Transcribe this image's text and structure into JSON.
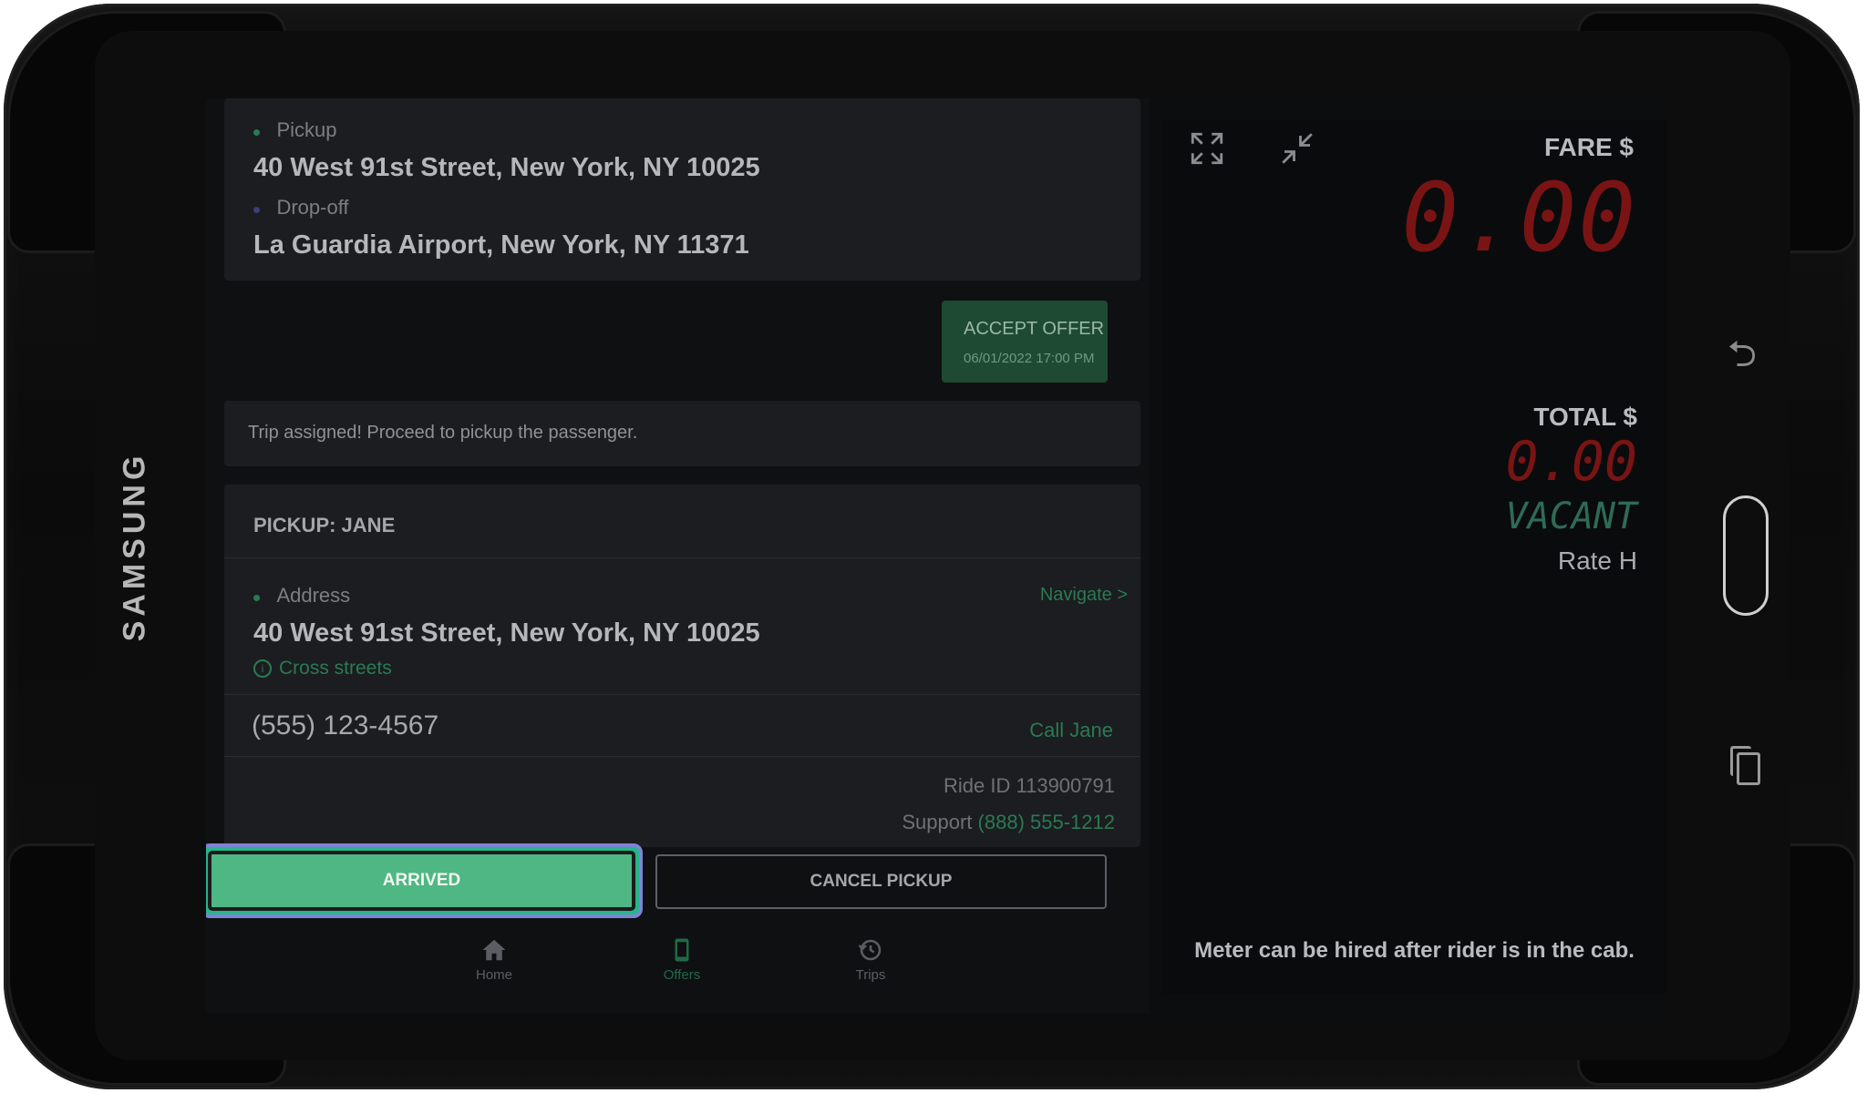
{
  "device": {
    "brand": "SAMSUNG"
  },
  "trip": {
    "pickup_label": "Pickup",
    "pickup_address": "40 West 91st Street, New York, NY 10025",
    "dropoff_label": "Drop-off",
    "dropoff_address": "La Guardia Airport, New York, NY 11371"
  },
  "offer": {
    "label": "ACCEPT OFFER",
    "timestamp": "06/01/2022 17:00 PM"
  },
  "status_message": "Trip assigned! Proceed to pickup the passenger.",
  "pickup_card": {
    "title": "PICKUP: JANE",
    "address_label": "Address",
    "navigate_link": "Navigate >",
    "address": "40 West 91st Street, New York, NY 10025",
    "cross_streets_link": "Cross streets",
    "phone": "(555) 123-4567",
    "call_link": "Call Jane",
    "ride_id": "Ride ID 113900791",
    "support_label": "Support",
    "support_phone": "(888) 555-1212"
  },
  "actions": {
    "arrived": "ARRIVED",
    "cancel": "CANCEL PICKUP"
  },
  "bottom_nav": [
    {
      "label": "Home",
      "icon": "home-icon",
      "active": false
    },
    {
      "label": "Offers",
      "icon": "phone-icon",
      "active": true
    },
    {
      "label": "Trips",
      "icon": "history-icon",
      "active": false
    }
  ],
  "meter": {
    "fare_label": "FARE $",
    "fare_value": "0.00",
    "total_label": "TOTAL $",
    "total_value": "0.00",
    "status": "VACANT",
    "rate": "Rate H",
    "note": "Meter can be hired after rider is in the cab."
  },
  "colors": {
    "accent_green": "#4fb783",
    "meter_red": "#7a1414",
    "vacant_green": "#2e6b55",
    "link_green": "#2b7a52"
  }
}
